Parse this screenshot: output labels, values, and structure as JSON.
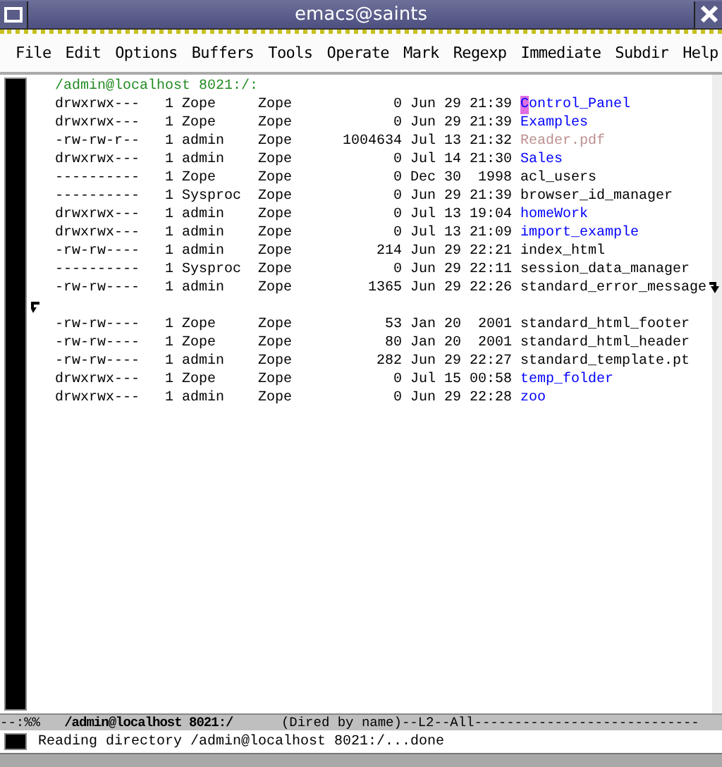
{
  "window": {
    "title": "emacs@saints"
  },
  "menu": [
    "File",
    "Edit",
    "Options",
    "Buffers",
    "Tools",
    "Operate",
    "Mark",
    "Regexp",
    "Immediate",
    "Subdir",
    "Help"
  ],
  "dired": {
    "header": "/admin@localhost 8021:/:",
    "rows": [
      {
        "perms": "drwxrwx---",
        "links": "1",
        "owner": "Zope",
        "group": "Zope",
        "size": "0",
        "date": "Jun 29",
        "time": "21:39",
        "name": "Control_Panel",
        "kind": "dir",
        "cursor": true
      },
      {
        "perms": "drwxrwx---",
        "links": "1",
        "owner": "Zope",
        "group": "Zope",
        "size": "0",
        "date": "Jun 29",
        "time": "21:39",
        "name": "Examples",
        "kind": "dir",
        "cursor": false
      },
      {
        "perms": "-rw-rw-r--",
        "links": "1",
        "owner": "admin",
        "group": "Zope",
        "size": "1004634",
        "date": "Jul 13",
        "time": "21:32",
        "name": "Reader.pdf",
        "kind": "pdf",
        "cursor": false
      },
      {
        "perms": "drwxrwx---",
        "links": "1",
        "owner": "admin",
        "group": "Zope",
        "size": "0",
        "date": "Jul 14",
        "time": "21:30",
        "name": "Sales",
        "kind": "dir",
        "cursor": false
      },
      {
        "perms": "----------",
        "links": "1",
        "owner": "Zope",
        "group": "Zope",
        "size": "0",
        "date": "Dec 30",
        "time": "1998",
        "name": "acl_users",
        "kind": "file",
        "cursor": false
      },
      {
        "perms": "----------",
        "links": "1",
        "owner": "Sysproc",
        "group": "Zope",
        "size": "0",
        "date": "Jun 29",
        "time": "21:39",
        "name": "browser_id_manager",
        "kind": "file",
        "cursor": false
      },
      {
        "perms": "drwxrwx---",
        "links": "1",
        "owner": "admin",
        "group": "Zope",
        "size": "0",
        "date": "Jul 13",
        "time": "19:04",
        "name": "homeWork",
        "kind": "dir",
        "cursor": false
      },
      {
        "perms": "drwxrwx---",
        "links": "1",
        "owner": "admin",
        "group": "Zope",
        "size": "0",
        "date": "Jul 13",
        "time": "21:09",
        "name": "import_example",
        "kind": "dir",
        "cursor": false
      },
      {
        "perms": "-rw-rw----",
        "links": "1",
        "owner": "admin",
        "group": "Zope",
        "size": "214",
        "date": "Jun 29",
        "time": "22:21",
        "name": "index_html",
        "kind": "file",
        "cursor": false
      },
      {
        "perms": "----------",
        "links": "1",
        "owner": "Sysproc",
        "group": "Zope",
        "size": "0",
        "date": "Jun 29",
        "time": "22:11",
        "name": "session_data_manager",
        "kind": "file",
        "cursor": false
      },
      {
        "perms": "-rw-rw----",
        "links": "1",
        "owner": "admin",
        "group": "Zope",
        "size": "1365",
        "date": "Jun 29",
        "time": "22:26",
        "name": "standard_error_message",
        "kind": "file",
        "cursor": false,
        "wrapped": true
      },
      {
        "perms": "-rw-rw----",
        "links": "1",
        "owner": "Zope",
        "group": "Zope",
        "size": "53",
        "date": "Jan 20",
        "time": "2001",
        "name": "standard_html_footer",
        "kind": "file",
        "cursor": false
      },
      {
        "perms": "-rw-rw----",
        "links": "1",
        "owner": "Zope",
        "group": "Zope",
        "size": "80",
        "date": "Jan 20",
        "time": "2001",
        "name": "standard_html_header",
        "kind": "file",
        "cursor": false
      },
      {
        "perms": "-rw-rw----",
        "links": "1",
        "owner": "admin",
        "group": "Zope",
        "size": "282",
        "date": "Jun 29",
        "time": "22:27",
        "name": "standard_template.pt",
        "kind": "file",
        "cursor": false
      },
      {
        "perms": "drwxrwx---",
        "links": "1",
        "owner": "Zope",
        "group": "Zope",
        "size": "0",
        "date": "Jul 15",
        "time": "00:58",
        "name": "temp_folder",
        "kind": "dir",
        "cursor": false
      },
      {
        "perms": "drwxrwx---",
        "links": "1",
        "owner": "admin",
        "group": "Zope",
        "size": "0",
        "date": "Jun 29",
        "time": "22:28",
        "name": "zoo",
        "kind": "dir",
        "cursor": false
      }
    ]
  },
  "mode_line": {
    "status": "--:%%",
    "buffer": "/admin@localhost 8021:/",
    "info": "(Dired by name)--L2--All----------------------------"
  },
  "echo": "Reading directory /admin@localhost 8021:/...done"
}
